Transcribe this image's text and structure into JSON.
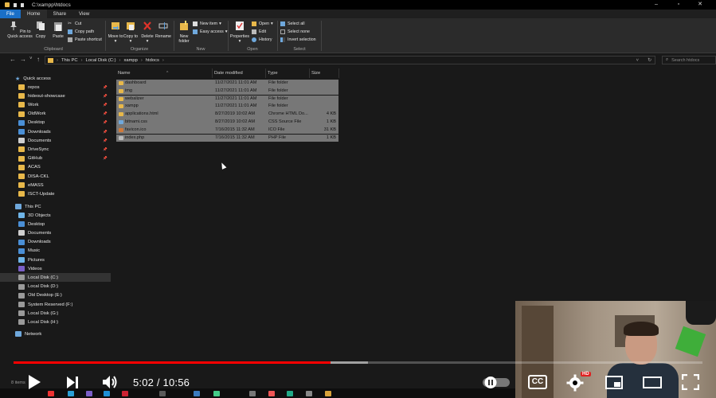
{
  "window": {
    "title": "C:\\xampp\\htdocs",
    "controls": [
      "minimize",
      "maximize",
      "close"
    ]
  },
  "ribbon_tabs": [
    {
      "label": "File"
    },
    {
      "label": "Home"
    },
    {
      "label": "Share"
    },
    {
      "label": "View"
    }
  ],
  "ribbon": {
    "clipboard": {
      "pin": "Pin to Quick access",
      "copy": "Copy",
      "paste": "Paste",
      "cut": "Cut",
      "copy_path": "Copy path",
      "paste_shortcut": "Paste shortcut",
      "label": "Clipboard"
    },
    "organize": {
      "move_to": "Move to",
      "copy_to": "Copy to",
      "delete": "Delete",
      "rename": "Rename",
      "label": "Organize"
    },
    "new": {
      "new_folder": "New folder",
      "new_item": "New item",
      "easy_access": "Easy access",
      "label": "New"
    },
    "open": {
      "properties": "Properties",
      "open": "Open",
      "edit": "Edit",
      "history": "History",
      "label": "Open"
    },
    "select": {
      "select_all": "Select all",
      "select_none": "Select none",
      "invert": "Invert selection",
      "label": "Select"
    }
  },
  "address": {
    "crumbs": [
      "This PC",
      "Local Disk (C:)",
      "xampp",
      "htdocs"
    ],
    "search_placeholder": "Search htdocs"
  },
  "nav": {
    "quick_access": "Quick access",
    "items": [
      {
        "label": "repos",
        "pinned": true,
        "icon": "folder-icon"
      },
      {
        "label": "hideout-showcase",
        "pinned": true,
        "icon": "folder-icon"
      },
      {
        "label": "Work",
        "pinned": true,
        "icon": "folder-icon"
      },
      {
        "label": "OldWork",
        "pinned": true,
        "icon": "folder-icon"
      },
      {
        "label": "Desktop",
        "pinned": true,
        "icon": "desktop-icon"
      },
      {
        "label": "Downloads",
        "pinned": true,
        "icon": "downloads-icon"
      },
      {
        "label": "Documents",
        "pinned": true,
        "icon": "documents-icon"
      },
      {
        "label": "DriveSync",
        "pinned": true,
        "icon": "folder-icon"
      },
      {
        "label": "GitHub",
        "pinned": true,
        "icon": "folder-icon"
      },
      {
        "label": "ACAS",
        "pinned": false,
        "icon": "folder-icon"
      },
      {
        "label": "DISA-CKL",
        "pinned": false,
        "icon": "folder-icon"
      },
      {
        "label": "eMASS",
        "pinned": false,
        "icon": "folder-icon"
      },
      {
        "label": "ISCT-Update",
        "pinned": false,
        "icon": "folder-icon"
      }
    ],
    "this_pc": "This PC",
    "pc_items": [
      {
        "label": "3D Objects",
        "icon": "3d-objects-icon"
      },
      {
        "label": "Desktop",
        "icon": "desktop-icon"
      },
      {
        "label": "Documents",
        "icon": "documents-icon"
      },
      {
        "label": "Downloads",
        "icon": "downloads-icon"
      },
      {
        "label": "Music",
        "icon": "music-icon"
      },
      {
        "label": "Pictures",
        "icon": "pictures-icon"
      },
      {
        "label": "Videos",
        "icon": "videos-icon"
      },
      {
        "label": "Local Disk (C:)",
        "icon": "drive-icon",
        "selected": true
      },
      {
        "label": "Local Disk (D:)",
        "icon": "drive-icon"
      },
      {
        "label": "Old Desktop (E:)",
        "icon": "drive-icon"
      },
      {
        "label": "System Reserved (F:)",
        "icon": "drive-icon"
      },
      {
        "label": "Local Disk (G:)",
        "icon": "drive-icon"
      },
      {
        "label": "Local Disk (H:)",
        "icon": "drive-icon"
      }
    ],
    "network": "Network"
  },
  "columns": {
    "name": "Name",
    "date": "Date modified",
    "type": "Type",
    "size": "Size"
  },
  "files": [
    {
      "name": "dashboard",
      "date": "11/27/2021 11:01 AM",
      "type": "File folder",
      "size": "",
      "icon": "folder-icon"
    },
    {
      "name": "img",
      "date": "11/27/2021 11:01 AM",
      "type": "File folder",
      "size": "",
      "icon": "folder-icon"
    },
    {
      "name": "webalizer",
      "date": "11/27/2021 11:01 AM",
      "type": "File folder",
      "size": "",
      "icon": "folder-icon"
    },
    {
      "name": "xampp",
      "date": "11/27/2021 11:01 AM",
      "type": "File folder",
      "size": "",
      "icon": "folder-icon"
    },
    {
      "name": "applications.html",
      "date": "8/27/2019 10:02 AM",
      "type": "Chrome HTML Do...",
      "size": "4 KB",
      "icon": "chrome-html-icon"
    },
    {
      "name": "bitnami.css",
      "date": "8/27/2019 10:02 AM",
      "type": "CSS Source File",
      "size": "1 KB",
      "icon": "css-file-icon"
    },
    {
      "name": "favicon.ico",
      "date": "7/16/2015 11:32 AM",
      "type": "ICO File",
      "size": "31 KB",
      "icon": "ico-file-icon"
    },
    {
      "name": "index.php",
      "date": "7/16/2015 11:32 AM",
      "type": "PHP File",
      "size": "1 KB",
      "icon": "php-file-icon"
    }
  ],
  "status": {
    "items_count": "8 items"
  },
  "player": {
    "current_time": "5:02",
    "duration": "10:56",
    "time_display": "5:02 / 10:56",
    "played_fraction": 0.46,
    "buffered_fraction": 0.515,
    "cc_label": "CC",
    "hd_badge": "HD"
  },
  "colors": {
    "file_tab": "#1a6fc7",
    "folder": "#e8b84a",
    "selection": "#777777",
    "progress_played": "#ff0000"
  }
}
